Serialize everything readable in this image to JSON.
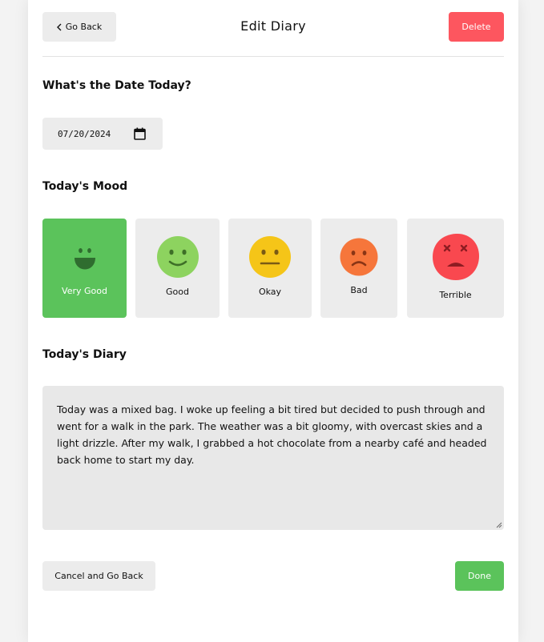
{
  "header": {
    "back_label": "Go Back",
    "title": "Edit Diary",
    "delete_label": "Delete"
  },
  "date_section": {
    "title": "What's the Date Today?",
    "value": "07/20/2024"
  },
  "mood_section": {
    "title": "Today's Mood",
    "selected": "Very Good",
    "options": [
      {
        "label": "Very Good",
        "color": "#5bc35b"
      },
      {
        "label": "Good",
        "color": "#8dd35f"
      },
      {
        "label": "Okay",
        "color": "#f5c518"
      },
      {
        "label": "Bad",
        "color": "#f6763b"
      },
      {
        "label": "Terrible",
        "color": "#f9484f"
      }
    ]
  },
  "diary_section": {
    "title": "Today's Diary",
    "content": "Today was a mixed bag. I woke up feeling a bit tired but decided to push through and went for a walk in the park. The weather was a bit gloomy, with overcast skies and a light drizzle. After my walk, I grabbed a hot chocolate from a nearby café and headed back home to start my day."
  },
  "footer": {
    "cancel_label": "Cancel and Go Back",
    "done_label": "Done"
  },
  "colors": {
    "accent_green": "#5bc35b",
    "delete_red": "#fd565f",
    "neutral_gray": "#ececec"
  }
}
